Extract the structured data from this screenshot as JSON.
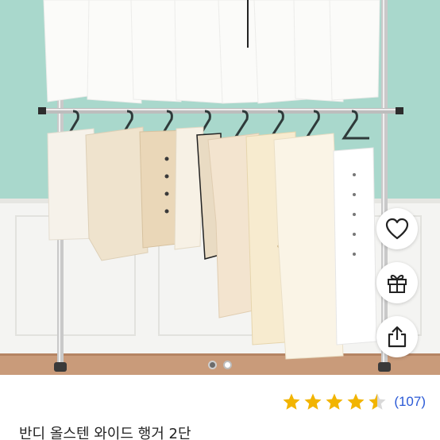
{
  "product": {
    "title": "반디 올스텐 와이드 행거 2단",
    "review_count_text": "(107)",
    "rating": 4.5,
    "rating_max": 5
  },
  "gallery": {
    "current_index": 1,
    "total": 2
  },
  "actions": {
    "like_icon": "heart-icon",
    "gift_icon": "gift-icon",
    "share_icon": "share-icon"
  },
  "colors": {
    "star": "#f2b400",
    "star_empty": "#d9d9d9",
    "review_link": "#2a59d6",
    "wall": "#a9d8cc",
    "wainscot": "#f3f3f1",
    "floor": "#c99b7a"
  }
}
